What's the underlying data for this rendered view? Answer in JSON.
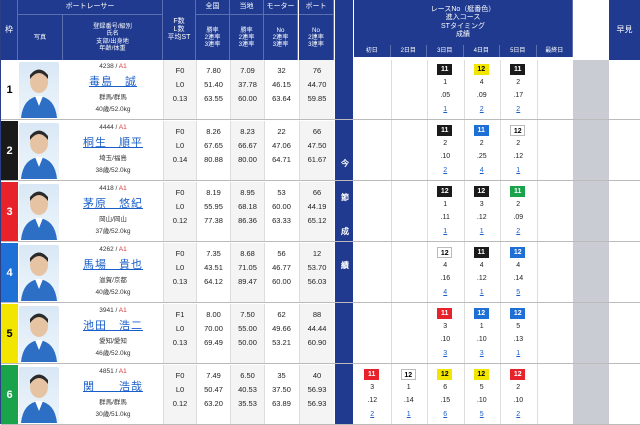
{
  "headers": {
    "lane": "枠",
    "photo": "写真",
    "racer_group": "ボートレーサー",
    "racer_fields": [
      "登録番号/級別",
      "氏名",
      "支部/出身地",
      "年齢/体重"
    ],
    "fl": [
      "F数",
      "L数",
      "平均ST"
    ],
    "national": "全国",
    "local": "当地",
    "motor": "モーター",
    "boat": "ボート",
    "win_rates": [
      "勝率",
      "2連率",
      "3連率"
    ],
    "machine_rates": [
      "No",
      "2連率",
      "3連率"
    ],
    "race_group": [
      "レースNo（艇番色）",
      "進入コース",
      "STタイミング",
      "成績"
    ],
    "days": [
      "初日",
      "2日目",
      "3日目",
      "4日目",
      "5日目",
      "最終日"
    ],
    "zenken": "早見",
    "midbar": [
      "今",
      "節",
      "成",
      "績"
    ]
  },
  "racers": [
    {
      "lane": "1",
      "lane_color": "#ffffff",
      "lane_text": "#000000",
      "reg": "4238",
      "cls": "A1",
      "name": "毒島　誠",
      "home": "群馬/群馬",
      "age": "40歳/52.0kg",
      "f": "F0",
      "l": "L0",
      "st": "0.13",
      "nat": [
        "7.80",
        "51.40",
        "63.55"
      ],
      "loc": [
        "7.09",
        "37.78",
        "60.00"
      ],
      "mot": [
        "32",
        "46.15",
        "63.64"
      ],
      "boa": [
        "76",
        "44.70",
        "59.85"
      ],
      "results": [
        {
          "day": 2,
          "race": "11",
          "color": "c2",
          "course": "1",
          "st": ".05",
          "rank": "1"
        },
        {
          "day": 3,
          "race": "12",
          "color": "c5",
          "course": "4",
          "st": ".09",
          "rank": "2"
        },
        {
          "day": 4,
          "race": "11",
          "color": "c2",
          "course": "2",
          "st": ".17",
          "rank": "2"
        }
      ]
    },
    {
      "lane": "2",
      "lane_color": "#1a1a1a",
      "lane_text": "#ffffff",
      "reg": "4444",
      "cls": "A1",
      "name": "桐生　順平",
      "home": "埼玉/福島",
      "age": "38歳/52.0kg",
      "f": "F0",
      "l": "L0",
      "st": "0.14",
      "nat": [
        "8.26",
        "67.65",
        "80.88"
      ],
      "loc": [
        "8.23",
        "66.67",
        "80.00"
      ],
      "mot": [
        "22",
        "47.06",
        "64.71"
      ],
      "boa": [
        "66",
        "47.50",
        "61.67"
      ],
      "results": [
        {
          "day": 2,
          "race": "11",
          "color": "c2",
          "course": "2",
          "st": ".10",
          "rank": "2"
        },
        {
          "day": 3,
          "race": "11",
          "color": "c4",
          "course": "2",
          "st": ".25",
          "rank": "4"
        },
        {
          "day": 4,
          "race": "12",
          "color": "c1",
          "course": "2",
          "st": ".12",
          "rank": "1"
        }
      ]
    },
    {
      "lane": "3",
      "lane_color": "#e8222b",
      "lane_text": "#ffffff",
      "reg": "4418",
      "cls": "A1",
      "name": "茅原　悠紀",
      "home": "岡山/岡山",
      "age": "37歳/52.0kg",
      "f": "F0",
      "l": "L0",
      "st": "0.12",
      "nat": [
        "8.19",
        "55.95",
        "77.38"
      ],
      "loc": [
        "8.95",
        "68.18",
        "86.36"
      ],
      "mot": [
        "53",
        "60.00",
        "63.33"
      ],
      "boa": [
        "66",
        "44.19",
        "65.12"
      ],
      "results": [
        {
          "day": 2,
          "race": "12",
          "color": "c2",
          "course": "1",
          "st": ".11",
          "rank": "1"
        },
        {
          "day": 3,
          "race": "12",
          "color": "c2",
          "course": "3",
          "st": ".12",
          "rank": "1"
        },
        {
          "day": 4,
          "race": "11",
          "color": "c6",
          "course": "2",
          "st": ".09",
          "rank": "2"
        }
      ]
    },
    {
      "lane": "4",
      "lane_color": "#1e6fd6",
      "lane_text": "#ffffff",
      "reg": "4262",
      "cls": "A1",
      "name": "馬場　貴也",
      "home": "滋賀/京都",
      "age": "40歳/52.0kg",
      "f": "F0",
      "l": "L0",
      "st": "0.13",
      "nat": [
        "7.35",
        "43.51",
        "64.12"
      ],
      "loc": [
        "8.68",
        "71.05",
        "89.47"
      ],
      "mot": [
        "56",
        "46.77",
        "60.00"
      ],
      "boa": [
        "12",
        "53.70",
        "56.03"
      ],
      "results": [
        {
          "day": 2,
          "race": "12",
          "color": "c1",
          "course": "4",
          "st": ".16",
          "rank": "4"
        },
        {
          "day": 3,
          "race": "11",
          "color": "c2",
          "course": "4",
          "st": ".12",
          "rank": "1"
        },
        {
          "day": 4,
          "race": "12",
          "color": "c4",
          "course": "4",
          "st": ".14",
          "rank": "5"
        }
      ]
    },
    {
      "lane": "5",
      "lane_color": "#f2e600",
      "lane_text": "#000000",
      "reg": "3941",
      "cls": "A1",
      "name": "池田　浩二",
      "home": "愛知/愛知",
      "age": "46歳/52.0kg",
      "f": "F1",
      "l": "L0",
      "st": "0.13",
      "nat": [
        "8.00",
        "70.00",
        "69.49"
      ],
      "loc": [
        "7.50",
        "55.00",
        "50.00"
      ],
      "mot": [
        "62",
        "49.66",
        "53.21"
      ],
      "boa": [
        "88",
        "44.44",
        "60.90"
      ],
      "results": [
        {
          "day": 2,
          "race": "11",
          "color": "c3",
          "course": "3",
          "st": ".10",
          "rank": "3"
        },
        {
          "day": 3,
          "race": "12",
          "color": "c4",
          "course": "1",
          "st": ".10",
          "rank": "3"
        },
        {
          "day": 4,
          "race": "12",
          "color": "c4",
          "course": "5",
          "st": ".13",
          "rank": "1"
        }
      ]
    },
    {
      "lane": "6",
      "lane_color": "#1aa34a",
      "lane_text": "#ffffff",
      "reg": "4851",
      "cls": "A1",
      "name": "関　　浩哉",
      "home": "群馬/群馬",
      "age": "30歳/51.0kg",
      "f": "F0",
      "l": "L0",
      "st": "0.12",
      "nat": [
        "7.49",
        "50.47",
        "63.20"
      ],
      "loc": [
        "6.50",
        "40.53",
        "35.53"
      ],
      "mot": [
        "35",
        "37.50",
        "63.89"
      ],
      "boa": [
        "40",
        "56.93",
        "56.93"
      ],
      "results": [
        {
          "day": 0,
          "race": "11",
          "color": "c3",
          "course": "3",
          "st": ".12",
          "rank": "2"
        },
        {
          "day": 1,
          "race": "12",
          "color": "c1",
          "course": "1",
          "st": ".14",
          "rank": "1"
        },
        {
          "day": 2,
          "race": "12",
          "color": "c5",
          "course": "6",
          "st": ".15",
          "rank": "6"
        },
        {
          "day": 3,
          "race": "12",
          "color": "c5",
          "course": "5",
          "st": ".10",
          "rank": "5"
        },
        {
          "day": 4,
          "race": "12",
          "color": "c3",
          "course": "2",
          "st": ".10",
          "rank": "2"
        }
      ]
    }
  ]
}
